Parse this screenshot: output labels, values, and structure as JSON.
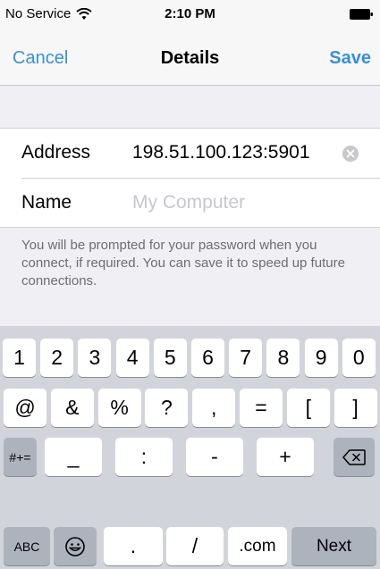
{
  "status_bar": {
    "carrier": "No Service",
    "time": "2:10 PM"
  },
  "nav": {
    "cancel": "Cancel",
    "title": "Details",
    "save": "Save"
  },
  "form": {
    "address_label": "Address",
    "address_value": "198.51.100.123:5901",
    "name_label": "Name",
    "name_placeholder": "My Computer",
    "name_value": ""
  },
  "footer_note": "You will be prompted for your password when you connect, if required. You can save it to speed up future connections.",
  "keyboard": {
    "row1": [
      "1",
      "2",
      "3",
      "4",
      "5",
      "6",
      "7",
      "8",
      "9",
      "0"
    ],
    "row2": [
      "@",
      "&",
      "%",
      "?",
      ",",
      "=",
      "[",
      "]"
    ],
    "row3": {
      "symbols": "#+=",
      "keys": [
        "_",
        ":",
        "-",
        "+"
      ]
    },
    "row4": {
      "abc": "ABC",
      "dot": ".",
      "slash": "/",
      "com": ".com",
      "next": "Next"
    }
  },
  "icons": {
    "wifi": "wifi-icon",
    "battery": "battery-icon",
    "clear": "clear-icon",
    "backspace": "backspace-icon",
    "emoji": "emoji-icon"
  },
  "colors": {
    "accent": "#3a8fd8",
    "keyboard_bg": "#d1d5db",
    "dark_key": "#adb3bc"
  }
}
